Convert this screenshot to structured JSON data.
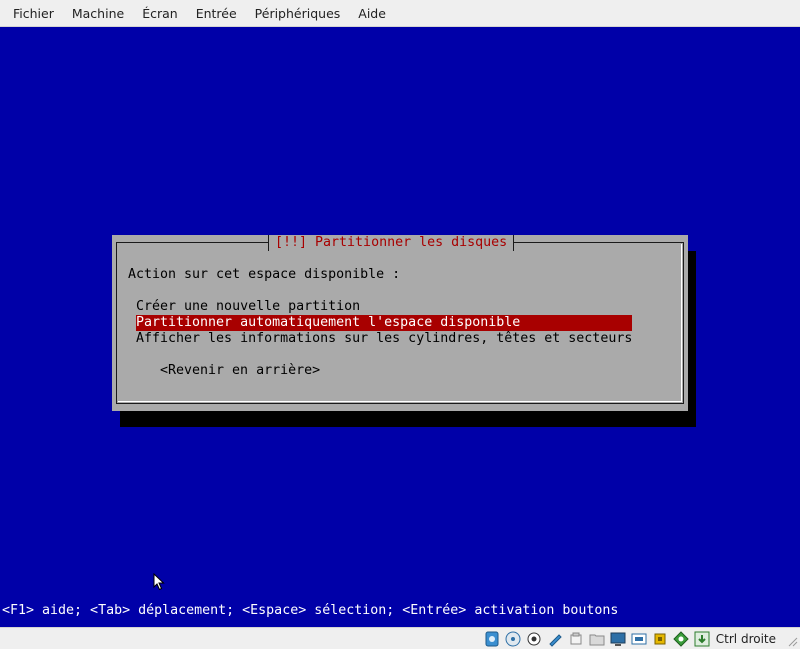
{
  "menubar": {
    "items": [
      "Fichier",
      "Machine",
      "Écran",
      "Entrée",
      "Périphériques",
      "Aide"
    ]
  },
  "dialog": {
    "title": "[!!] Partitionner les disques",
    "prompt": "Action sur cet espace disponible :",
    "options": [
      "Créer une nouvelle partition",
      "Partitionner automatiquement l'espace disponible",
      "Afficher les informations sur les cylindres, têtes et secteurs"
    ],
    "selected_index": 1,
    "back_label": "<Revenir en arrière>"
  },
  "help_line": "<F1> aide; <Tab> déplacement; <Espace> sélection; <Entrée> activation boutons",
  "statusbar": {
    "icons": [
      "hard-disk-icon",
      "optical-drive-icon",
      "audio-icon",
      "network-icon",
      "usb-icon",
      "shared-folders-icon",
      "display-icon",
      "video-capture-icon",
      "cpu-icon",
      "mouse-integration-icon",
      "keyboard-capture-icon"
    ],
    "host_key": "Ctrl droite"
  },
  "colors": {
    "guest_background": "#0000a8",
    "dialog_background": "#aaaaaa",
    "title_text": "#a80000",
    "selection": "#a80000"
  }
}
